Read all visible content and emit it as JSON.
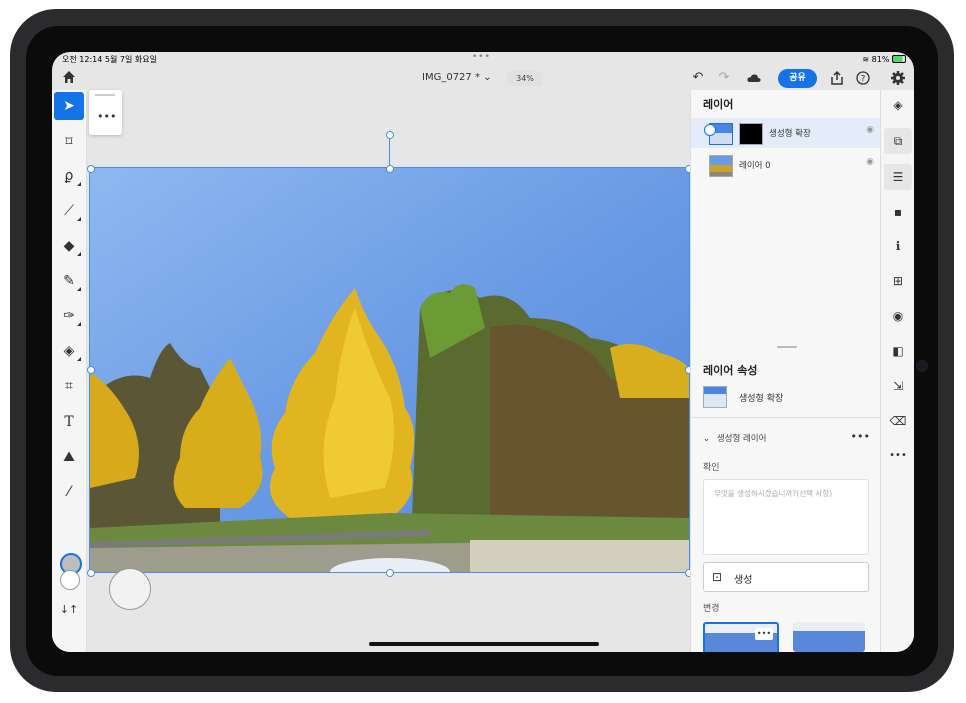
{
  "status": {
    "time": "오전 12:14  5월 7일 화요일",
    "battery": "81%"
  },
  "topbar": {
    "document_name": "IMG_0727 * ⌄",
    "zoom": "34%",
    "share_label": "공유"
  },
  "canvas": {
    "more_label": "•••"
  },
  "layers": {
    "title": "레이어",
    "items": [
      {
        "name": "생성형 확장",
        "selected": true
      },
      {
        "name": "레이어 0",
        "selected": false
      }
    ]
  },
  "properties": {
    "title": "레이어 속성",
    "layer_name": "생성형 확장",
    "section_title": "생성형 레이어",
    "section_more": "•••",
    "confirm_label": "확인",
    "prompt_placeholder": "무엇을 생성하시겠습니까?(선택 사항)",
    "generate_label": "생성",
    "variants_label": "변경",
    "variant_more": "•••"
  },
  "colors": {
    "accent": "#1473e6",
    "foreground_swatch": "#bdbdbd",
    "background_swatch": "#ffffff"
  },
  "icons": {
    "toolbar": [
      "select-arrow-icon",
      "transform-icon",
      "lasso-icon",
      "brush-icon",
      "eraser-icon",
      "healing-icon",
      "smudge-icon",
      "fill-icon",
      "crop-icon",
      "text-icon",
      "adjust-icon",
      "eyedropper-icon",
      "swap-icon"
    ],
    "rail": [
      "layers-icon",
      "layer-properties-icon",
      "adjustments-icon",
      "comments-icon",
      "info-icon",
      "add-layer-icon",
      "visibility-icon",
      "mask-icon",
      "import-icon",
      "eraser-rail-icon",
      "more-icon"
    ]
  }
}
